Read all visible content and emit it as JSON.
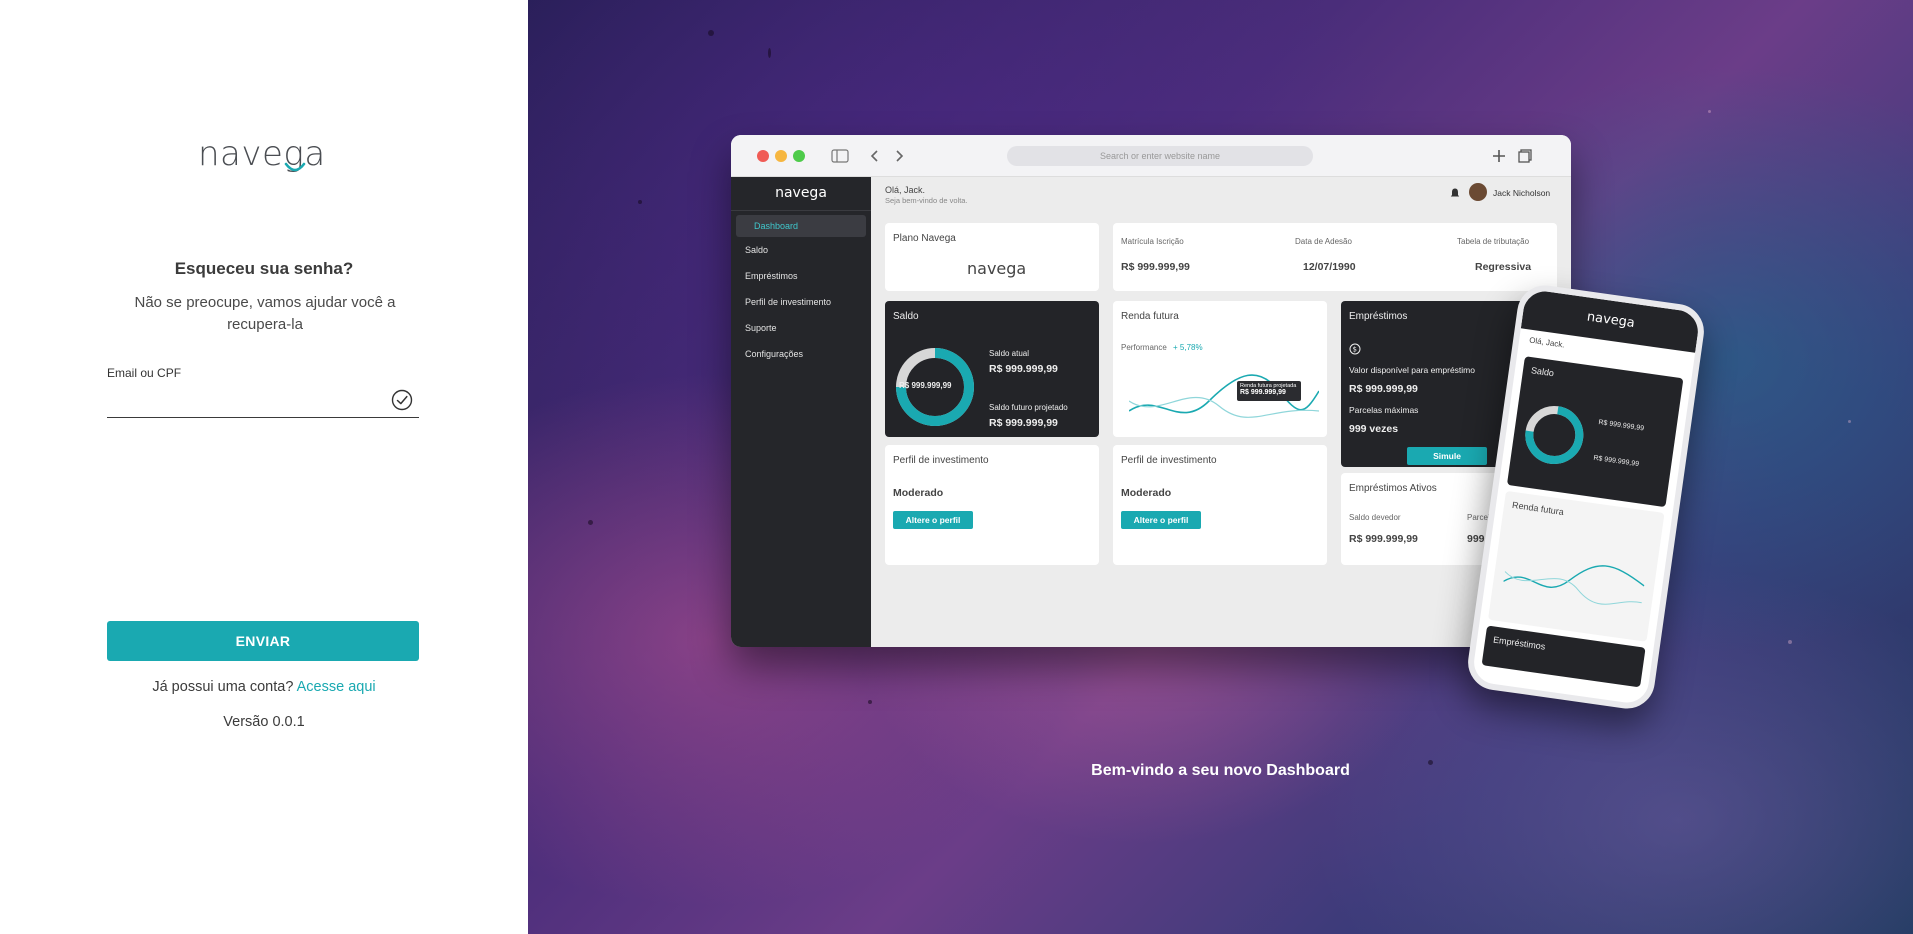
{
  "brand": {
    "name": "navega",
    "accent": "#1aa9b1"
  },
  "form": {
    "title": "Esqueceu sua senha?",
    "subtitle": "Não se preocupe, vamos ajudar você a recupera-la",
    "email_label": "Email ou CPF",
    "email_value": "",
    "submit_label": "ENVIAR",
    "account_text": "Já possui uma conta?",
    "account_link": "Acesse aqui",
    "version": "Versão 0.0.1"
  },
  "hero": {
    "welcome": "Bem-vindo a seu novo Dashboard",
    "browser": {
      "address_placeholder": "Search or enter website name",
      "greeting": "Olá, Jack.",
      "greeting_sub": "Seja bem-vindo de volta.",
      "user_name": "Jack Nicholson",
      "nav": [
        "Dashboard",
        "Saldo",
        "Empréstimos",
        "Perfil de investimento",
        "Suporte",
        "Configurações"
      ],
      "plano": "Plano Navega",
      "matricula_label": "Matrícula Iscrição",
      "matricula_value": "R$ 999.999,99",
      "adesao_label": "Data de Adesão",
      "adesao_value": "12/07/1990",
      "tabela_label": "Tabela de tributação",
      "tabela_value": "Regressiva",
      "saldo_title": "Saldo",
      "saldo_center": "R$ 999.999,99",
      "saldo_atual_label": "Saldo atual",
      "saldo_atual_value": "R$ 999.999,99",
      "saldo_futuro_label": "Saldo futuro projetado",
      "saldo_futuro_value": "R$ 999.999,99",
      "renda_title": "Renda futura",
      "performance_label": "Performance",
      "performance_value": "+ 5,78%",
      "tooltip_label": "Renda futura projetada",
      "tooltip_value": "R$ 999.999,99",
      "emprestimos_title": "Empréstimos",
      "valor_label": "Valor disponível para empréstimo",
      "valor_value": "R$ 999.999,99",
      "parcelas_label": "Parcelas máximas",
      "parcelas_value": "999 vezes",
      "simule": "Simule",
      "perfil_title": "Perfil de investimento",
      "perfil_value": "Moderado",
      "altere": "Altere o perfil",
      "ativos_title": "Empréstimos Ativos",
      "devedor_label": "Saldo devedor",
      "devedor_value": "R$ 999.999,99",
      "parcelas2_label": "Parcelas",
      "parcelas2_value": "999"
    }
  }
}
